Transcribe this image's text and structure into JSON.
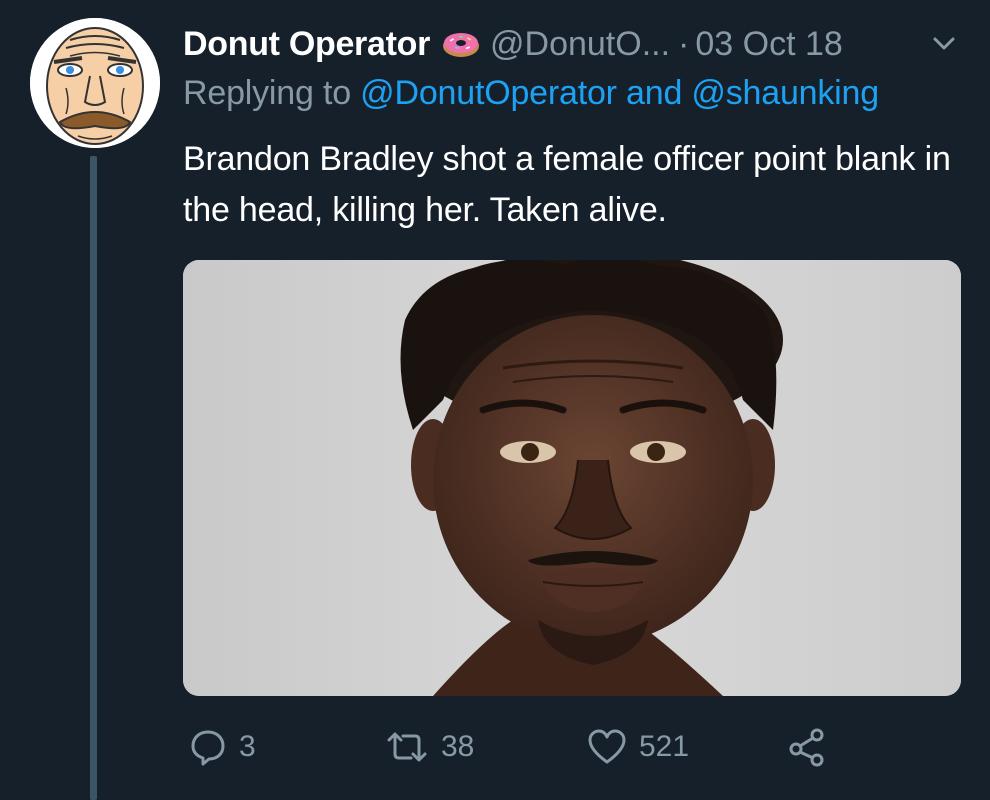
{
  "tweet": {
    "display_name": "Donut Operator",
    "handle": "@DonutO...",
    "dot_separator": "·",
    "timestamp": "03 Oct 18",
    "reply": {
      "prefix": "Replying to",
      "mention_1": "@DonutOperator",
      "conjunction": "and",
      "mention_2": "@shaunking"
    },
    "text": "Brandon Bradley shot a female officer point blank in the head, killing her. Taken alive.",
    "media": {
      "alt": "mugshot-photo"
    }
  },
  "actions": {
    "reply_count": "3",
    "retweet_count": "38",
    "like_count": "521"
  },
  "icons": {
    "chevron": "chevron-down-icon",
    "reply": "reply-bubble-icon",
    "retweet": "retweet-icon",
    "like": "heart-icon",
    "share": "share-icon",
    "donut": "donut-emoji-icon"
  },
  "colors": {
    "background": "#15202b",
    "text_primary": "#ffffff",
    "text_secondary": "#8899a6",
    "link": "#1da1f2",
    "thread_line": "#3d5467"
  }
}
